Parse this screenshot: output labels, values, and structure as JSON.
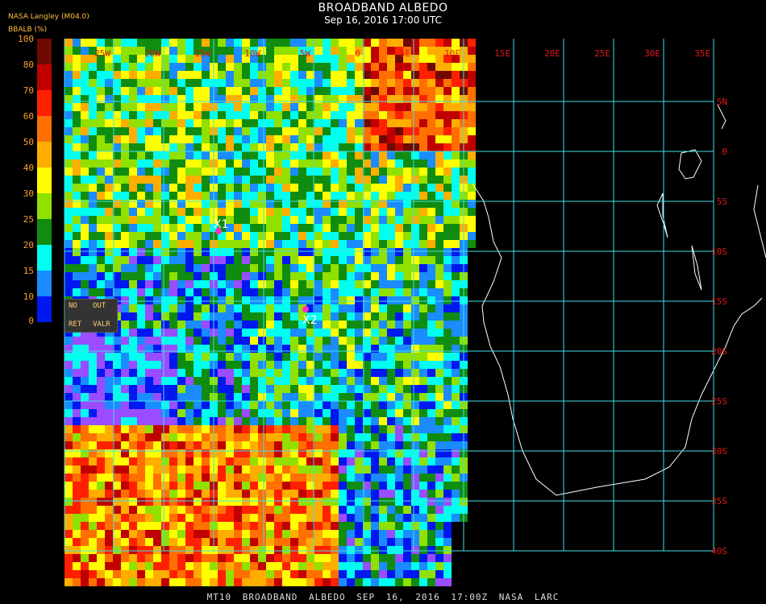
{
  "header": {
    "title": "BROADBAND ALBEDO",
    "subtitle": "Sep 16, 2016 17:00 UTC",
    "source": "NASA Langley (M04.0)",
    "unit": "BBALB (%)"
  },
  "legend": {
    "ticks": [
      "100",
      "80",
      "70",
      "60",
      "50",
      "40",
      "30",
      "25",
      "20",
      "15",
      "10",
      "0"
    ],
    "colors": [
      "#6e0a00",
      "#c00000",
      "#ff2000",
      "#ff7000",
      "#ffae00",
      "#ffff00",
      "#90e000",
      "#108c10",
      "#00ffee",
      "#1a8cff",
      "#0018f0",
      "#9a4cff"
    ],
    "key": {
      "no_ret_a": "NO",
      "no_ret_b": "RET",
      "out_a": "OUT",
      "out_b": "VALR"
    }
  },
  "grid": {
    "lon_labels": [
      "25W",
      "20W",
      "15W",
      "10W",
      "5W",
      "0",
      "5E",
      "10E",
      "15E",
      "20E",
      "25E",
      "30E",
      "35E"
    ],
    "lat_labels": [
      "5N",
      "0",
      "5S",
      "10S",
      "15S",
      "20S",
      "25S",
      "30S",
      "35S",
      "40S"
    ]
  },
  "markers": [
    {
      "label": "X1"
    },
    {
      "label": "X2"
    }
  ],
  "footer": "MT10 BROADBAND ALBEDO SEP 16, 2016 17:00Z NASA LARC"
}
